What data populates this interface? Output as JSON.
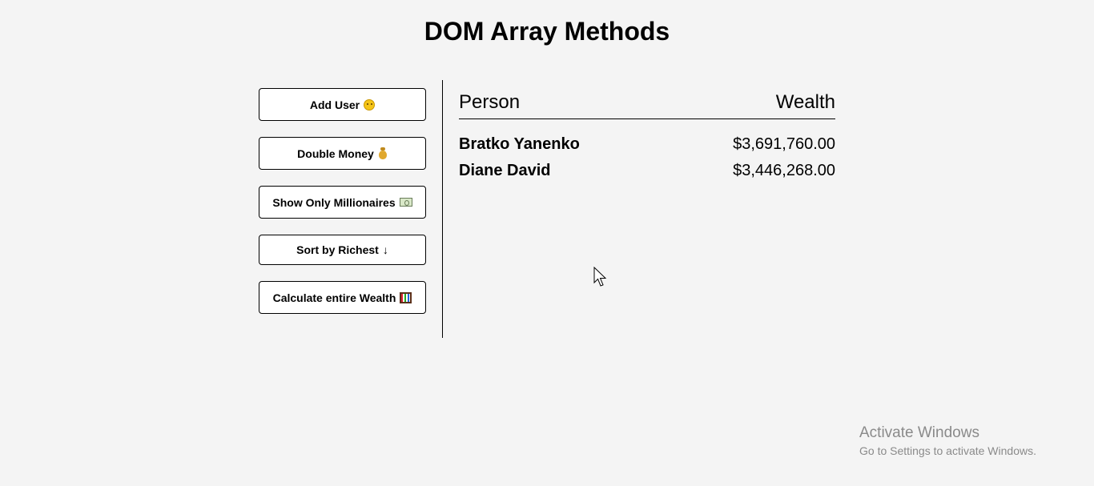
{
  "header": {
    "title": "DOM Array Methods"
  },
  "actions": {
    "add_user": {
      "label": "Add User",
      "icon": "face-icon"
    },
    "double_money": {
      "label": "Double Money",
      "icon": "money-bag-icon"
    },
    "show_millionaires": {
      "label": "Show Only Millionaires",
      "icon": "banknote-icon"
    },
    "sort_richest": {
      "label": "Sort by Richest",
      "arrow": "↓"
    },
    "calculate_wealth": {
      "label": "Calculate entire Wealth",
      "icon": "abacus-icon"
    }
  },
  "table": {
    "columns": {
      "person": "Person",
      "wealth": "Wealth"
    },
    "rows": [
      {
        "name": "Bratko Yanenko",
        "wealth": "$3,691,760.00"
      },
      {
        "name": "Diane David",
        "wealth": "$3,446,268.00"
      }
    ]
  },
  "watermark": {
    "line1": "Activate Windows",
    "line2": "Go to Settings to activate Windows."
  },
  "colors": {
    "background": "#f4f4f4",
    "button_background": "#ffffff",
    "text": "#000000",
    "watermark": "#8a8a8a"
  }
}
